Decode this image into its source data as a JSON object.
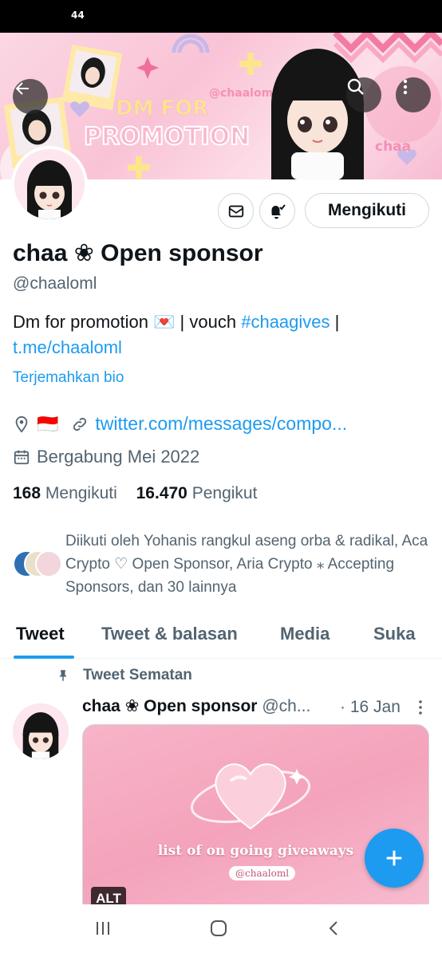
{
  "status_bar": {
    "time": "44"
  },
  "banner": {
    "text_line1": "DM FOR",
    "text_line2": "PROMOTION",
    "handle_tag": "@chaaloml",
    "sticker": "chaa",
    "colors": {
      "pink": "#f9c3d6",
      "accent": "#ee8fb0"
    }
  },
  "header_buttons": {
    "back": "arrow-left-icon",
    "search": "search-icon",
    "more": "more-vertical-icon"
  },
  "actions": {
    "message_icon": "mail-icon",
    "notify_icon": "bell-check-icon",
    "follow_label": "Mengikuti"
  },
  "profile": {
    "display_name": "chaa ❀ Open sponsor",
    "handle": "@chaaloml",
    "bio_text": "Dm for promotion 💌 | vouch ",
    "bio_hashtag": "#chaagives",
    "bio_sep": " | ",
    "bio_link": "t.me/chaaloml",
    "translate_label": "Terjemahkan bio",
    "location_flag": "🇮🇩",
    "website": "twitter.com/messages/compo...",
    "joined": "Bergabung Mei 2022",
    "following_count": "168",
    "following_label": "Mengikuti",
    "followers_count": "16.470",
    "followers_label": "Pengikut",
    "followed_by": "Diikuti oleh Yohanis rangkul aseng orba & radikal, Aca Crypto ♡ Open Sponsor, Aria Crypto ⁎ Accepting Sponsors, dan 30 lainnya"
  },
  "tabs": [
    {
      "label": "Tweet",
      "active": true
    },
    {
      "label": "Tweet & balasan",
      "active": false
    },
    {
      "label": "Media",
      "active": false
    },
    {
      "label": "Suka",
      "active": false
    }
  ],
  "pinned_tweet": {
    "pinned_label": "Tweet Sematan",
    "name": "chaa ❀ Open sponsor",
    "handle": "@ch...",
    "date": "· 16 Jan",
    "media_text": "list of on going giveaways",
    "media_handle": "@chaaloml",
    "alt_label": "ALT"
  },
  "fab": {
    "icon": "plus-icon"
  },
  "nav_bar": {
    "recents": "recents-icon",
    "home": "home-icon",
    "back": "back-chevron-icon"
  },
  "colors": {
    "link": "#1d9bf0",
    "muted": "#536471",
    "text": "#0f1419"
  }
}
